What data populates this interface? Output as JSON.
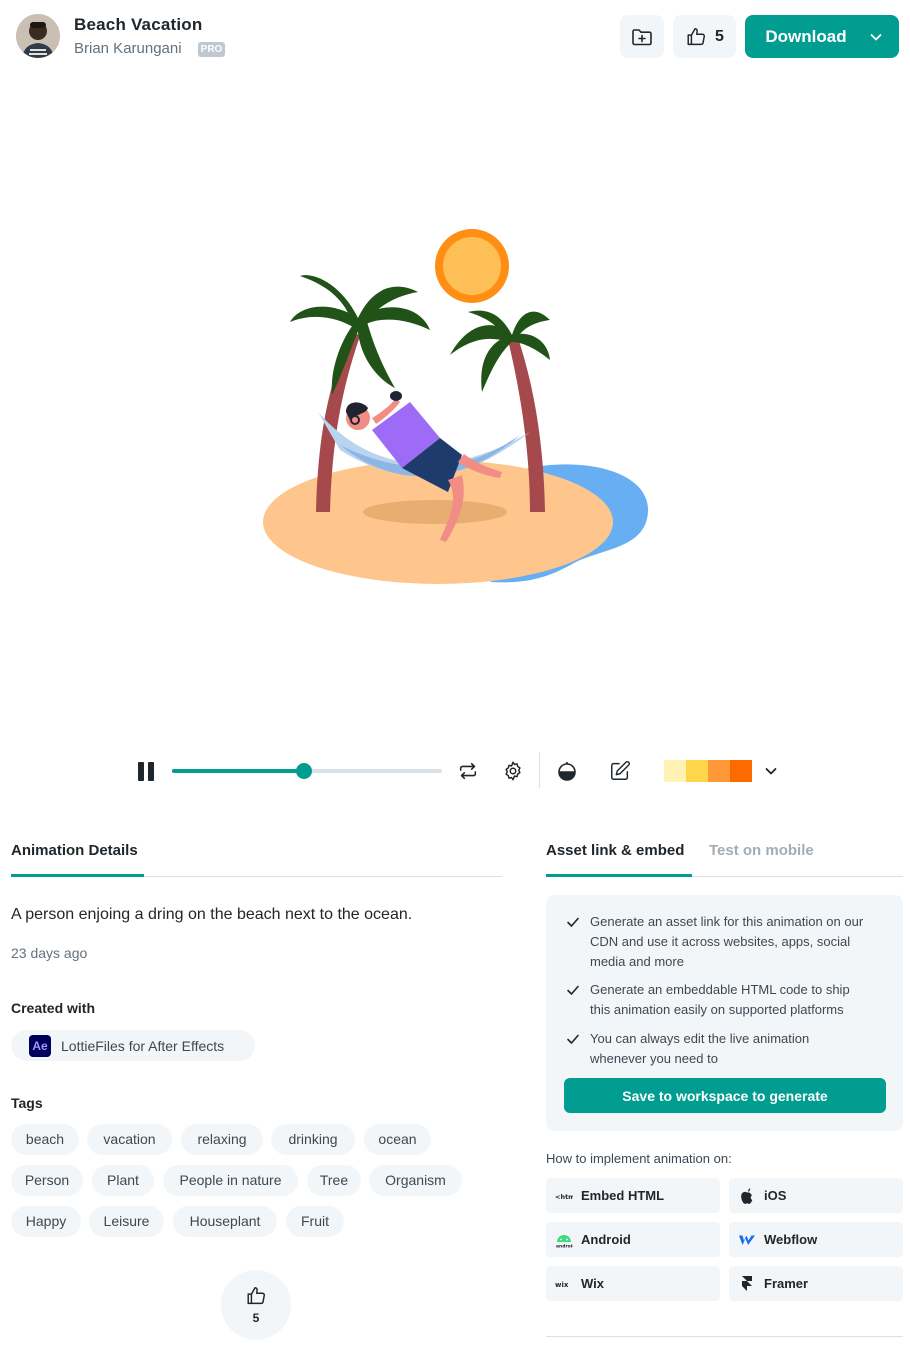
{
  "header": {
    "title": "Beach Vacation",
    "author": "Brian Karungani",
    "pro_badge": "PRO",
    "like_count": "5",
    "download_label": "Download"
  },
  "player": {
    "progress_fraction": 0.49,
    "palette_colors": [
      "#fff2b3",
      "#ffd54a",
      "#ff9838",
      "#fd6b00"
    ]
  },
  "details": {
    "tab_label": "Animation Details",
    "description": "A person enjoing a dring on the beach next to the ocean.",
    "time_ago": "23 days ago",
    "created_heading": "Created with",
    "created_tool": "LottieFiles for After Effects",
    "tool_logo_text": "Ae",
    "tags_heading": "Tags",
    "tags": [
      "beach",
      "vacation",
      "relaxing",
      "drinking",
      "ocean",
      "Person",
      "Plant",
      "People in nature",
      "Tree",
      "Organism",
      "Happy",
      "Leisure",
      "Houseplant",
      "Fruit"
    ],
    "like_count": "5"
  },
  "asset": {
    "tab_active": "Asset link & embed",
    "tab_inactive": "Test on mobile",
    "features": [
      "Generate an asset link for this animation on our CDN and use it across websites, apps, social media and more",
      "Generate an embeddable HTML code to ship this animation easily on supported platforms",
      "You can always edit the live animation whenever you need to"
    ],
    "generate_label": "Save to workspace to generate",
    "howto_label": "How to implement animation on:",
    "platforms": [
      "Embed HTML",
      "iOS",
      "Android",
      "Webflow",
      "Wix",
      "Framer"
    ]
  },
  "colors": {
    "accent": "#019d91",
    "chip_bg": "#f3f6f8"
  }
}
